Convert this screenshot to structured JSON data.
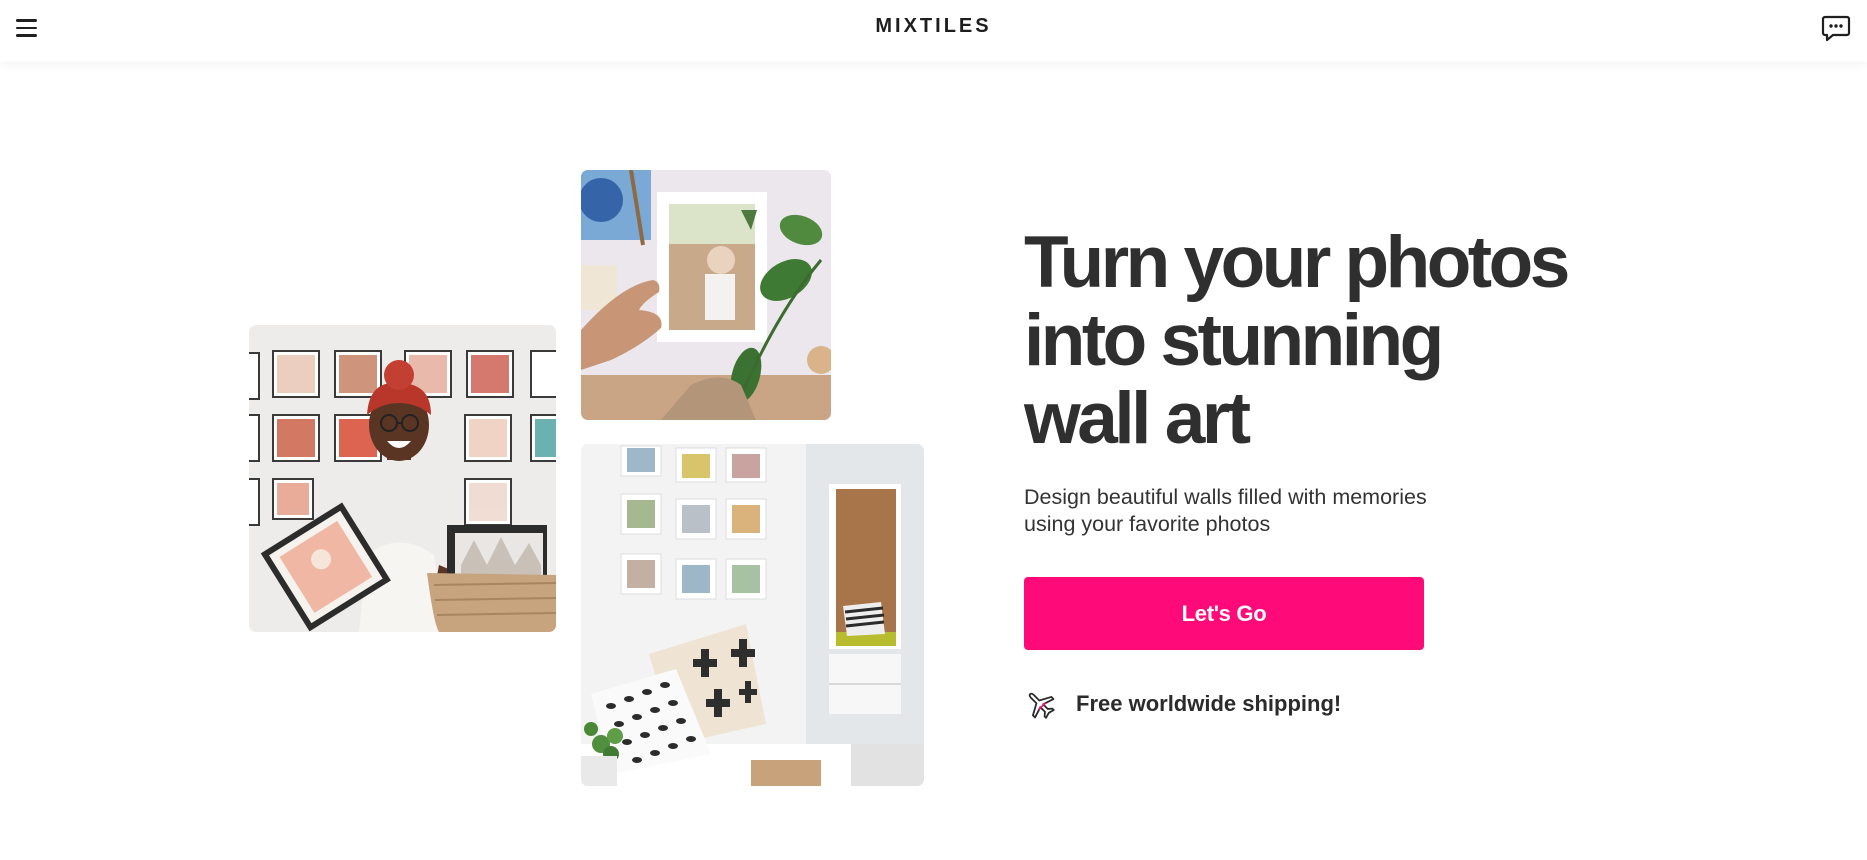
{
  "header": {
    "brand": "MIXTILES",
    "menu_icon": "hamburger-menu-icon",
    "chat_icon": "chat-bubble-icon"
  },
  "hero": {
    "title_lines": [
      "Turn your photos",
      "into stunning",
      "wall art"
    ],
    "subtitle_lines": [
      "Design beautiful walls filled with memories",
      "using your favorite photos"
    ],
    "cta_label": "Let's Go",
    "shipping_text": "Free worldwide shipping!",
    "shipping_icon": "airplane-icon"
  },
  "images": [
    {
      "name": "woman-holding-frames-photo",
      "description": "Smiling woman holding framed photos in front of a gallery wall"
    },
    {
      "name": "hand-placing-tile-photo",
      "description": "Hand placing a photo tile on a wall next to a plant"
    },
    {
      "name": "hallway-gallery-wall-photo",
      "description": "White entryway with photo tiles, bench and patterned pillows"
    }
  ],
  "colors": {
    "accent": "#ff0a78",
    "text": "#2f2f2f",
    "background": "#ffffff"
  }
}
